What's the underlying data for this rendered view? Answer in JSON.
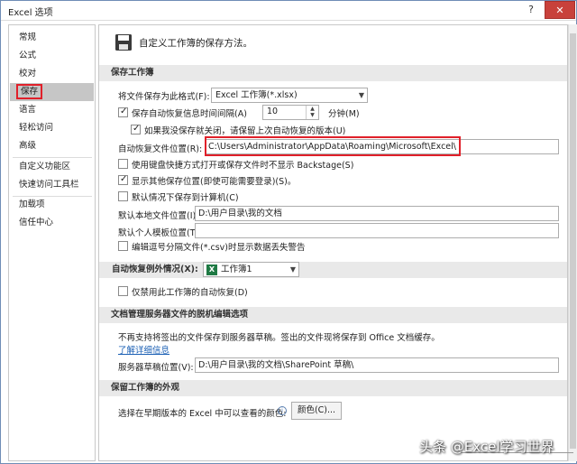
{
  "window": {
    "title": "Excel 选项",
    "help_glyph": "?",
    "close_glyph": "✕"
  },
  "sidebar": {
    "items": [
      {
        "label": "常规"
      },
      {
        "label": "公式"
      },
      {
        "label": "校对"
      },
      {
        "label": "保存"
      },
      {
        "label": "语言"
      },
      {
        "label": "轻松访问"
      },
      {
        "label": "高级"
      },
      {
        "label": "自定义功能区"
      },
      {
        "label": "快速访问工具栏"
      },
      {
        "label": "加载项"
      },
      {
        "label": "信任中心"
      }
    ],
    "selected": "保存"
  },
  "header": {
    "text": "自定义工作簿的保存方法。"
  },
  "save_workbooks": {
    "section_title": "保存工作簿",
    "format_label": "将文件保存为此格式(F):",
    "format_value": "Excel 工作簿(*.xlsx)",
    "autorecover_label": "保存自动恢复信息时间间隔(A)",
    "autorecover_checked": true,
    "autorecover_minutes": "10",
    "minutes_unit": "分钟(M)",
    "keep_last_label": "如果我没保存就关闭，请保留上次自动恢复的版本(U)",
    "keep_last_checked": true,
    "autorecover_location_label": "自动恢复文件位置(R):",
    "autorecover_location_value": "C:\\Users\\Administrator\\AppData\\Roaming\\Microsoft\\Excel\\",
    "no_backstage_label": "使用键盘快捷方式打开或保存文件时不显示 Backstage(S)",
    "no_backstage_checked": false,
    "show_additional_label": "显示其他保存位置(即使可能需要登录)(S)。",
    "show_additional_checked": true,
    "save_to_computer_label": "默认情况下保存到计算机(C)",
    "save_to_computer_checked": false,
    "default_local_label": "默认本地文件位置(I):",
    "default_local_value": "D:\\用户目录\\我的文档",
    "default_template_label": "默认个人模板位置(T):",
    "default_template_value": "",
    "csv_warning_label": "编辑逗号分隔文件(*.csv)时显示数据丢失警告",
    "csv_warning_checked": false
  },
  "autorecover_exceptions": {
    "label": "自动恢复例外情况(X):",
    "workbook_value": "工作簿1",
    "disable_label": "仅禁用此工作簿的自动恢复(D)",
    "disable_checked": false
  },
  "offline_editing": {
    "section_title": "文档管理服务器文件的脱机编辑选项",
    "description": "不再支持将签出的文件保存到服务器草稿。签出的文件现将保存到 Office 文档缓存。",
    "learn_more": "了解详细信息",
    "drafts_label": "服务器草稿位置(V):",
    "drafts_value": "D:\\用户目录\\我的文档\\SharePoint 草稿\\"
  },
  "preserve_visual": {
    "section_title": "保留工作簿的外观",
    "colors_label": "选择在早期版本的 Excel 中可以查看的颜色:",
    "colors_button": "颜色(C)..."
  },
  "watermark": "头条 @Excel学习世界",
  "colors": {
    "highlight_red": "#e0202a",
    "close_red": "#c8413b",
    "selected_gray": "#c6c6c6",
    "section_gray": "#e9e9e9",
    "link_blue": "#1a5fb4"
  }
}
